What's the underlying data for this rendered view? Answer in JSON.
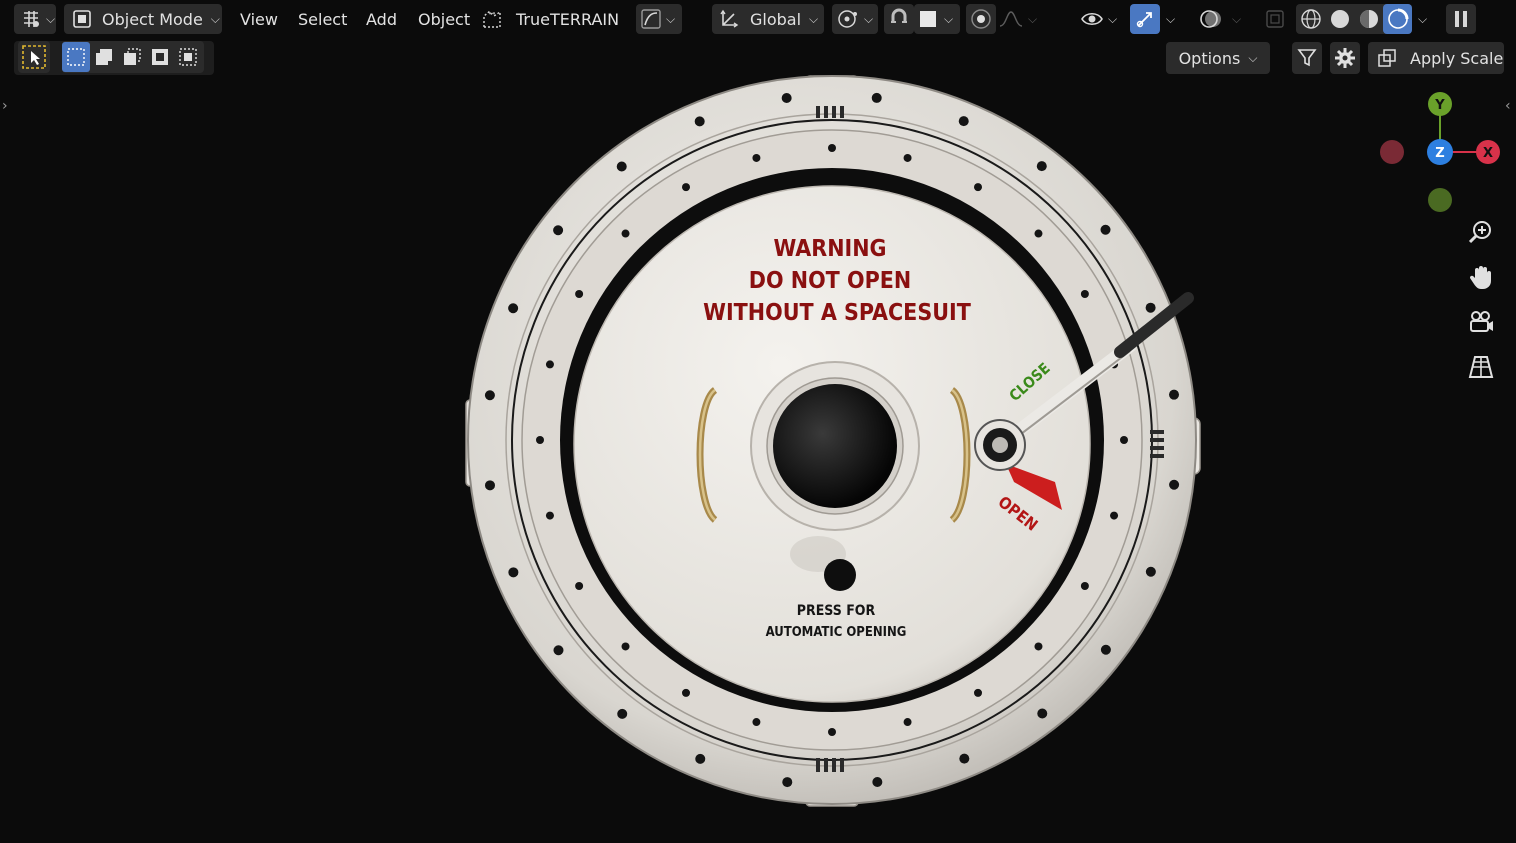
{
  "topbar": {
    "editor_type_label": "",
    "mode_label": "Object Mode",
    "menu": [
      "View",
      "Select",
      "Add",
      "Object"
    ],
    "addon_label": "TrueTERRAIN",
    "orientation_label": "Global"
  },
  "header2": {
    "options_label": "Options",
    "apply_scale_label": "Apply Scale"
  },
  "gizmo": {
    "y_label": "Y",
    "z_label": "Z",
    "x_label": "X"
  },
  "hatch": {
    "warning_line1": "WARNING",
    "warning_line2": "DO NOT OPEN",
    "warning_line3": "WITHOUT A SPACESUIT",
    "close_label": "CLOSE",
    "open_label": "OPEN",
    "press_line1": "PRESS FOR",
    "press_line2": "AUTOMATIC OPENING"
  },
  "colors": {
    "warning_red": "#8a1010",
    "close_green": "#3a8a1a",
    "open_red": "#c41a1a",
    "gizmo_y": "#6aa12a",
    "gizmo_z": "#2d7fe0",
    "gizmo_x": "#d8324a",
    "accent_blue": "#4a78c2"
  },
  "icons": [
    "editor-type-icon",
    "object-mode-icon",
    "terrain-icon",
    "curve-icon",
    "transform-orientation-icon",
    "pivot-icon",
    "snap-icon",
    "proportional-icon",
    "visibility-icon",
    "gizmo-toggle-icon",
    "overlay-icon",
    "xray-icon",
    "wireframe-shading-icon",
    "solid-shading-icon",
    "material-shading-icon",
    "rendered-shading-icon",
    "pause-icon",
    "select-tool-icon",
    "filter-icon",
    "gear-icon",
    "zoom-icon",
    "hand-icon",
    "camera-icon",
    "grid-icon"
  ]
}
